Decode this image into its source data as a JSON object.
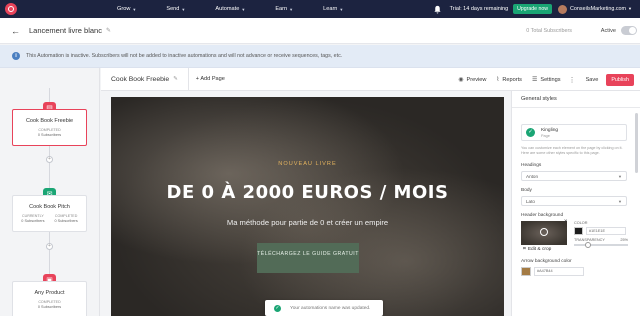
{
  "nav": {
    "items": [
      {
        "label": "Grow"
      },
      {
        "label": "Send"
      },
      {
        "label": "Automate"
      },
      {
        "label": "Earn"
      },
      {
        "label": "Learn"
      }
    ],
    "trial_text": "Trial: 14 days remaining",
    "upgrade_label": "Upgrade now",
    "account_name": "ConseilsMarketing.com"
  },
  "header": {
    "title": "Lancement livre blanc",
    "total_subscribers": "0 Total Subscribers",
    "active_label": "Active",
    "active_on": false
  },
  "banner": {
    "text": "This Automation is inactive. Subscribers will not be added to inactive automations and will not advance or receive sequences, tags, etc."
  },
  "flow": {
    "nodes": [
      {
        "title": "Cook Book Freebie",
        "color": "#e8435a",
        "icon": "page-icon",
        "stats": [
          {
            "label": "COMPLETED",
            "value": "0 Subscribers"
          }
        ]
      },
      {
        "title": "Cook Book Pitch",
        "color": "#1aa574",
        "icon": "email-icon",
        "stats": [
          {
            "label": "CURRENTLY",
            "value": "0 Subscribers"
          },
          {
            "label": "COMPLETED",
            "value": "0 Subscribers"
          }
        ]
      },
      {
        "title": "Any Product",
        "color": "#e8435a",
        "icon": "product-icon",
        "stats": [
          {
            "label": "COMPLETED",
            "value": "0 Subscribers"
          }
        ]
      }
    ]
  },
  "toolbar": {
    "page_name": "Cook Book Freebie",
    "add_page": "Add Page",
    "preview": "Preview",
    "reports": "Reports",
    "settings": "Settings",
    "save": "Save",
    "publish": "Publish"
  },
  "hero": {
    "kicker": "NOUVEAU LIVRE",
    "title": "DE 0 À 2000 EUROS / MOIS",
    "subtitle": "Ma méthode pour partie de 0 et créer un empire",
    "cta": "TÉLÉCHARGEZ LE GUIDE GRATUIT"
  },
  "toast": {
    "text": "Your automations name was updated."
  },
  "panel": {
    "title": "General styles",
    "template_name": "Kingling",
    "template_type": "Page",
    "help": "You can customize each element on the page by clicking on it. Here are some other styles specific to this page.",
    "headings_label": "Headings",
    "headings_value": "Anton",
    "body_label": "Body",
    "body_value": "Lato",
    "header_bg_label": "Header background",
    "edit_crop": "Edit & crop",
    "color_label": "COLOR",
    "color_hex": "#1E1E1E",
    "transparency_label": "TRANSPARENCY",
    "transparency_value": "25%",
    "transparency_fraction": 0.25,
    "arrow_bg_label": "Arrow background color",
    "arrow_hex": "#A47B44"
  },
  "colors": {
    "nav_bg": "#1c2340",
    "brand": "#e8435a",
    "success": "#1aa574",
    "cta_bg": "#526b57",
    "kicker": "#e4b35e"
  }
}
